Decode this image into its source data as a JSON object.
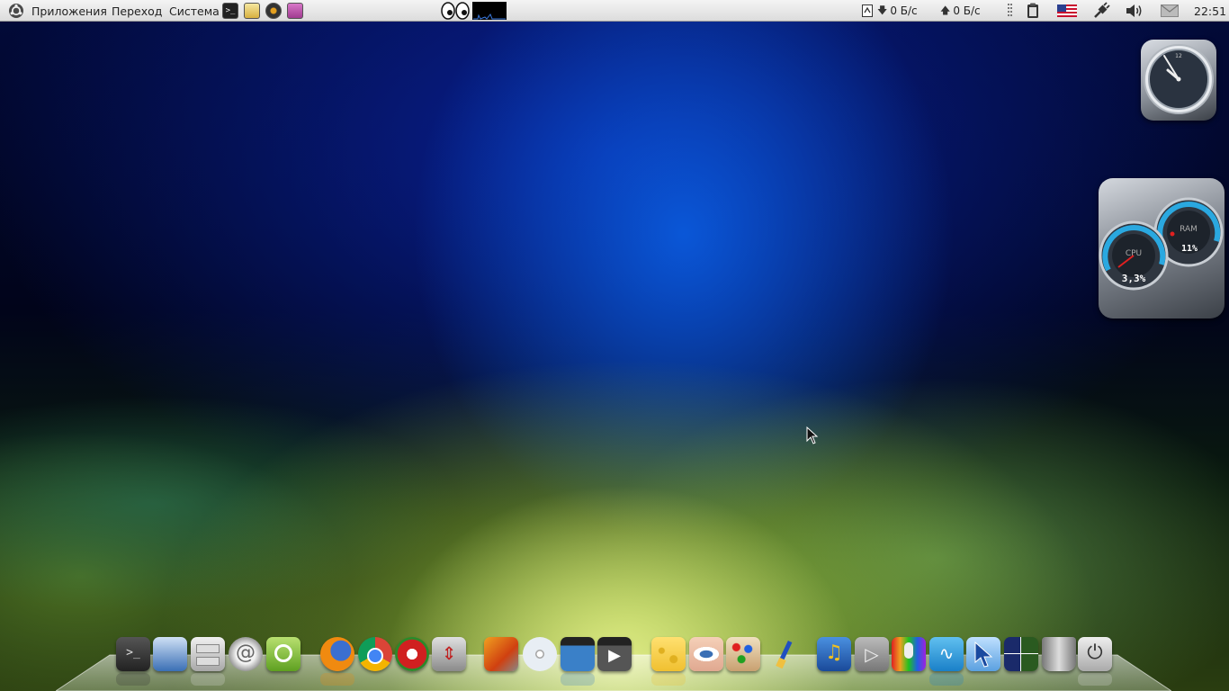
{
  "top_panel": {
    "menus": [
      "Приложения",
      "Переход",
      "Система"
    ],
    "net_down": "0 Б/с",
    "net_up": "0 Б/с",
    "clock": "22:51",
    "tray_icons": [
      "clipboard-icon",
      "us-flag-icon",
      "network-plug-icon",
      "volume-icon",
      "mail-icon"
    ]
  },
  "widgets": {
    "clock_labels": [
      "12"
    ],
    "cpu_label": "CPU",
    "cpu_value": "3,3%",
    "ram_label": "RAM",
    "ram_value": "11%"
  },
  "dock": {
    "icons": [
      "terminal-icon",
      "network-save-icon",
      "file-cabinet-icon",
      "email-at-icon",
      "ubuntu-software-icon",
      "firefox-icon",
      "chrome-icon",
      "torrent-magnet-icon",
      "screen-resize-icon",
      "tools-flame-icon",
      "cd-burner-icon",
      "video-editor-icon",
      "video-player-icon",
      "cheese-webcam-icon",
      "eye-screenshot-icon",
      "paint-palette-icon",
      "brush-icon",
      "music-player-icon",
      "media-play-icon",
      "microphone-mixer-icon",
      "system-monitor-icon",
      "cursor-arrow-icon",
      "workspace-switcher-icon",
      "trash-icon",
      "power-icon"
    ]
  },
  "colors": {
    "panel_bg": "#e4e4e4",
    "widget_glass": "#8a9099",
    "gauge_accent": "#2aa8e0"
  }
}
